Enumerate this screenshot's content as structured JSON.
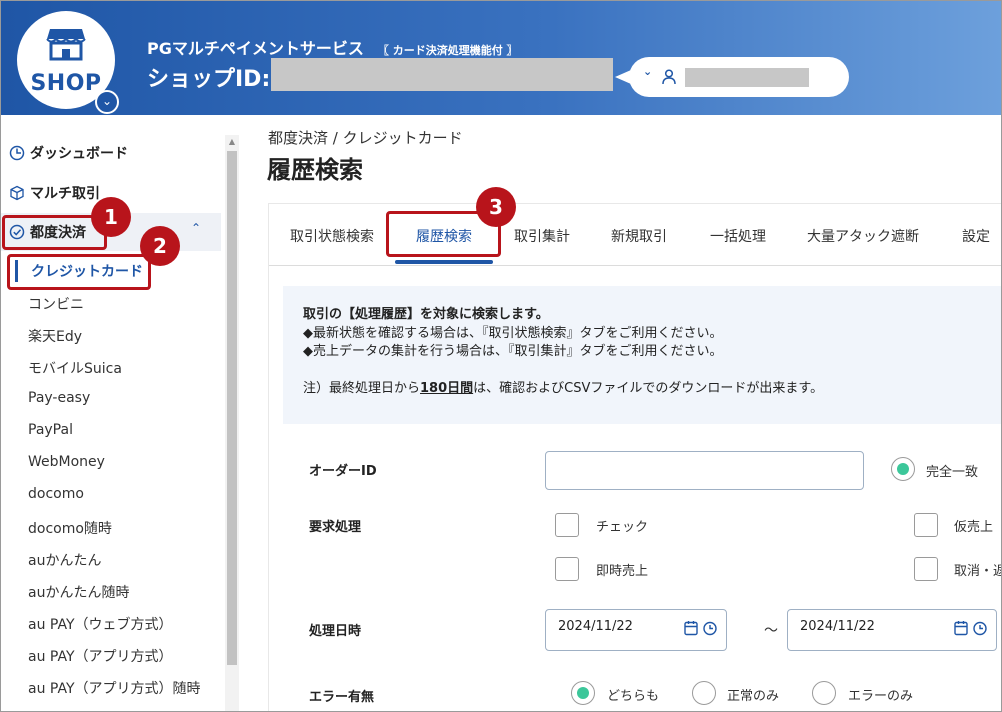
{
  "header": {
    "logo_text": "SHOP",
    "service_name": "PGマルチペイメントサービス",
    "service_tag": "〖 カード決済処理機能付 〗",
    "shop_id_label": "ショップID:"
  },
  "sidebar": {
    "top_items": [
      {
        "label": "ダッシュボード",
        "icon": "clock-icon"
      },
      {
        "label": "マルチ取引",
        "icon": "cube-icon"
      }
    ],
    "group": {
      "label": "都度決済",
      "icon": "check-circle-icon"
    },
    "active_sub": "クレジットカード",
    "sub_items": [
      "コンビニ",
      "楽天Edy",
      "モバイルSuica",
      "Pay-easy",
      "PayPal",
      "WebMoney",
      "docomo",
      "docomo随時",
      "auかんたん",
      "auかんたん随時",
      "au PAY（ウェブ方式）",
      "au PAY（アプリ方式）",
      "au PAY（アプリ方式）随時"
    ]
  },
  "main": {
    "breadcrumb": "都度決済 / クレジットカード",
    "title": "履歴検索",
    "tabs": [
      "取引状態検索",
      "履歴検索",
      "取引集計",
      "新規取引",
      "一括処理",
      "大量アタック遮断",
      "設定"
    ],
    "notice": {
      "line1": "取引の【処理履歴】を対象に検索します。",
      "line2": "◆最新状態を確認する場合は、『取引状態検索』タブをご利用ください。",
      "line3": "◆売上データの集計を行う場合は、『取引集計』タブをご利用ください。",
      "line4_pre": "注）最終処理日から",
      "line4_em": "180日間",
      "line4_post": "は、確認およびCSVファイルでのダウンロードが出来ます。"
    },
    "form": {
      "order_id_label": "オーダーID",
      "order_id_value": "",
      "exact_match": "完全一致",
      "request_label": "要求処理",
      "req_check": "チェック",
      "req_auth": "仮売上",
      "req_capture": "即時売上",
      "req_cancel": "取消・返",
      "date_label": "処理日時",
      "date_from": "2024/11/22",
      "date_to": "2024/11/22",
      "tilde": "～",
      "error_label": "エラー有無",
      "err_both": "どちらも",
      "err_ok": "正常のみ",
      "err_only": "エラーのみ"
    }
  },
  "callouts": [
    "1",
    "2",
    "3"
  ]
}
